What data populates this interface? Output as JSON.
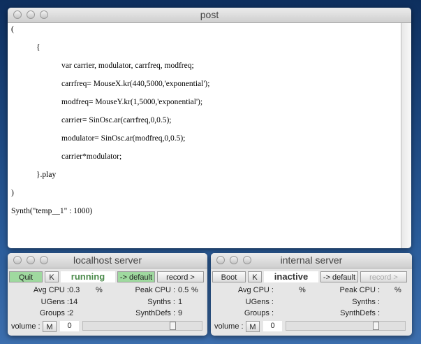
{
  "post": {
    "title": "post",
    "lines": [
      {
        "indent": 0,
        "text": "("
      },
      {
        "indent": 1,
        "text": "{"
      },
      {
        "indent": 2,
        "text": "var carrier, modulator, carrfreq, modfreq;"
      },
      {
        "indent": 2,
        "text": "carrfreq= MouseX.kr(440,5000,'exponential');"
      },
      {
        "indent": 2,
        "text": "modfreq= MouseY.kr(1,5000,'exponential');"
      },
      {
        "indent": 2,
        "text": "carrier= SinOsc.ar(carrfreq,0,0.5);"
      },
      {
        "indent": 2,
        "text": "modulator= SinOsc.ar(modfreq,0,0.5);"
      },
      {
        "indent": 2,
        "text": "carrier*modulator;"
      },
      {
        "indent": 1,
        "text": "}.play"
      },
      {
        "indent": 0,
        "text": ")"
      },
      {
        "indent": 0,
        "text": "Synth(\"temp__1\" : 1000)"
      }
    ]
  },
  "servers": [
    {
      "title": "localhost server",
      "boot_label": "Quit",
      "boot_active": true,
      "k_label": "K",
      "status": "running",
      "status_color": "#4a8a4a",
      "default_label": "-> default",
      "default_active": true,
      "record_label": "record >",
      "record_enabled": true,
      "avg_cpu_label": "Avg CPU :",
      "avg_cpu": "0.3",
      "peak_cpu_label": "Peak CPU :",
      "peak_cpu": "0.5",
      "percent": "%",
      "ugens_label": "UGens :",
      "ugens": "14",
      "synths_label": "Synths :",
      "synths": "1",
      "groups_label": "Groups :",
      "groups": "2",
      "synthdefs_label": "SynthDefs :",
      "synthdefs": "9",
      "volume_label": "volume :",
      "mute_label": "M",
      "volume_value": "0",
      "volume_level": 0.76
    },
    {
      "title": "internal server",
      "boot_label": "Boot",
      "boot_active": false,
      "k_label": "K",
      "status": "inactive",
      "status_color": "#333333",
      "default_label": "-> default",
      "default_active": false,
      "record_label": "record >",
      "record_enabled": false,
      "avg_cpu_label": "Avg CPU :",
      "avg_cpu": "",
      "peak_cpu_label": "Peak CPU :",
      "peak_cpu": "",
      "percent": "%",
      "ugens_label": "UGens :",
      "ugens": "",
      "synths_label": "Synths :",
      "synths": "",
      "groups_label": "Groups :",
      "groups": "",
      "synthdefs_label": "SynthDefs :",
      "synthdefs": "",
      "volume_label": "volume :",
      "mute_label": "M",
      "volume_value": "0",
      "volume_level": 0.76
    }
  ]
}
